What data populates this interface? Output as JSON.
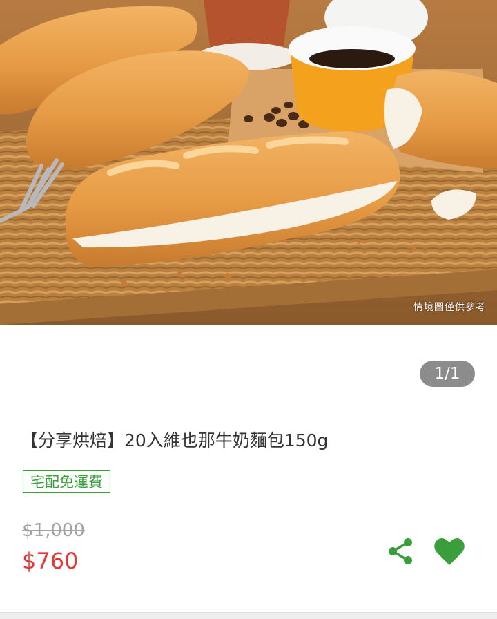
{
  "image": {
    "caption": "情境圖僅供參考",
    "counter": "1/1"
  },
  "product": {
    "title": "【分享烘焙】20入維也那牛奶麵包150g",
    "tag": "宅配免運費",
    "original_price": "$1,000",
    "sale_price": "$760"
  },
  "actions": {
    "share_icon": "share-icon",
    "favorite_icon": "heart-icon"
  },
  "colors": {
    "accent_green": "#3a9e3d",
    "price_red": "#e53935",
    "old_price_gray": "#a3a3a3",
    "counter_bg": "#8c8c8c"
  }
}
